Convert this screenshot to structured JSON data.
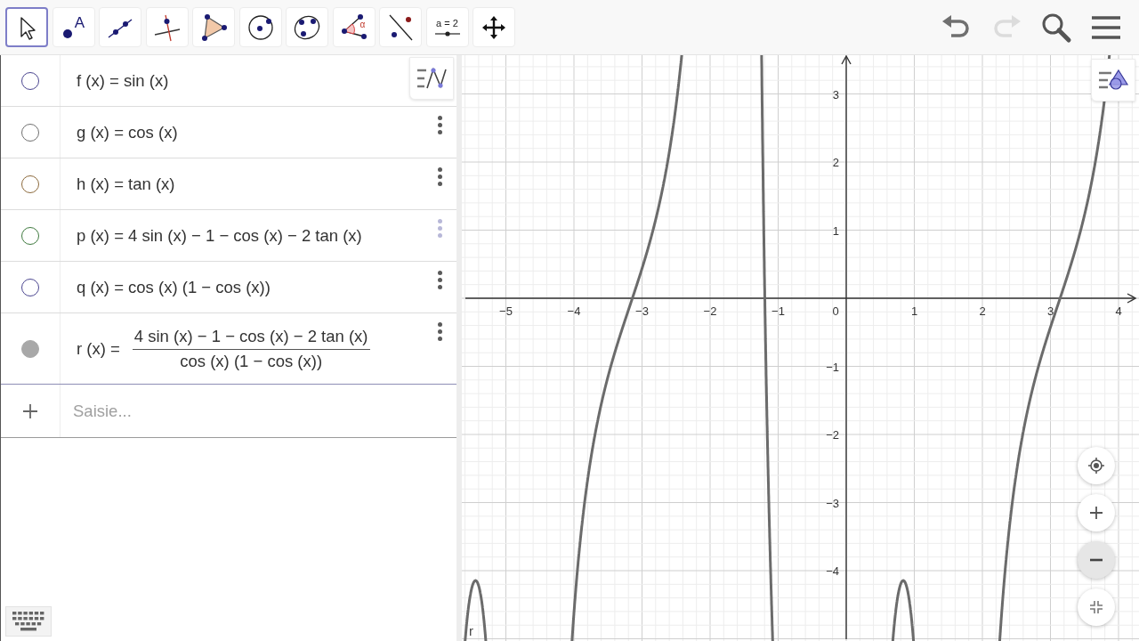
{
  "toolbar": {
    "tools": [
      {
        "kind": "move",
        "selected": true
      },
      {
        "kind": "point",
        "label": "A",
        "selected": false
      },
      {
        "kind": "line",
        "selected": false
      },
      {
        "kind": "perpendicular",
        "selected": false
      },
      {
        "kind": "polygon",
        "selected": false
      },
      {
        "kind": "circle",
        "selected": false
      },
      {
        "kind": "conic",
        "selected": false
      },
      {
        "kind": "angle",
        "label": "α",
        "selected": false
      },
      {
        "kind": "reflect",
        "selected": false
      },
      {
        "kind": "slider",
        "label": "a = 2",
        "selected": false
      },
      {
        "kind": "move_view",
        "selected": false
      }
    ],
    "actions": [
      {
        "kind": "undo",
        "disabled": false
      },
      {
        "kind": "redo",
        "disabled": true
      },
      {
        "kind": "search"
      },
      {
        "kind": "menu"
      }
    ]
  },
  "algebra": {
    "rows": [
      {
        "kind": "inline",
        "expression": "f (x) = sin (x)",
        "color": "#4b4690",
        "visible": false
      },
      {
        "kind": "inline",
        "expression": "g (x) = cos (x)",
        "color": "#6f6f6f",
        "visible": false,
        "menu_dimmed": false
      },
      {
        "kind": "inline",
        "expression": "h (x) = tan (x)",
        "color": "#8c6a3c",
        "visible": false,
        "menu_dimmed": false
      },
      {
        "kind": "inline",
        "expression": "p (x) = 4 sin (x) − 1 − cos (x) − 2 tan (x)",
        "color": "#3f7a3f",
        "visible": false,
        "menu_dimmed": true
      },
      {
        "kind": "inline",
        "expression": "q (x) = cos (x) (1 − cos (x))",
        "color": "#4b4690",
        "visible": false,
        "menu_dimmed": false
      },
      {
        "kind": "fraction",
        "lhs": "r (x) =",
        "numerator": "4 sin (x) − 1 − cos (x) − 2 tan (x)",
        "denominator": "cos (x) (1 − cos (x))",
        "color": "#a8a8a8",
        "visible": true,
        "menu_dimmed": false
      }
    ],
    "input": {
      "placeholder": "Saisie..."
    }
  },
  "graph": {
    "x_axis_labels": [
      "−5",
      "−4",
      "−3",
      "−2",
      "−1",
      "0",
      "1",
      "2",
      "3",
      "4"
    ],
    "y_axis_labels": [
      "3",
      "2",
      "1",
      "−1",
      "−2",
      "−3",
      "−4"
    ],
    "curve_label": "r",
    "zoom_buttons": [
      {
        "kind": "home",
        "pressed": false
      },
      {
        "kind": "zoom_in",
        "pressed": false
      },
      {
        "kind": "zoom_out",
        "pressed": true
      },
      {
        "kind": "fullscreen",
        "pressed": false
      }
    ]
  }
}
